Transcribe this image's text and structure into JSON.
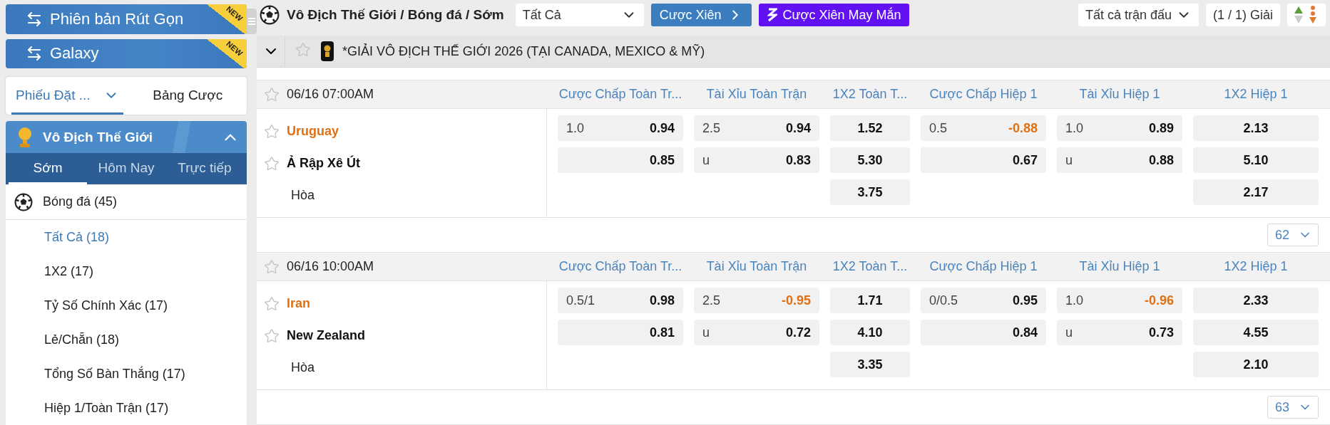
{
  "sidebar": {
    "banners": [
      {
        "label": "Phiên bản Rút Gọn",
        "badge": "NEW"
      },
      {
        "label": "Galaxy",
        "badge": "NEW"
      }
    ],
    "tabs": [
      {
        "label": "Phiếu Đặt ...",
        "selected": true,
        "dropdown": true
      },
      {
        "label": "Bảng Cược",
        "selected": false,
        "dropdown": false
      }
    ],
    "section": {
      "title": "Vô Địch Thế Giới",
      "expanded": true,
      "tabs": [
        {
          "label": "Sớm",
          "selected": true
        },
        {
          "label": "Hôm Nay",
          "selected": false
        },
        {
          "label": "Trực tiếp",
          "selected": false
        }
      ],
      "sport": {
        "label": "Bóng đá",
        "count": "(45)"
      },
      "items": [
        {
          "label": "Tất Cả",
          "count": "(18)",
          "selected": true
        },
        {
          "label": "1X2",
          "count": "(17)",
          "selected": false
        },
        {
          "label": "Tỷ Số Chính Xác",
          "count": "(17)",
          "selected": false
        },
        {
          "label": "Lẻ/Chẵn",
          "count": "(18)",
          "selected": false
        },
        {
          "label": "Tổng Số Bàn Thắng",
          "count": "(17)",
          "selected": false
        },
        {
          "label": "Hiệp 1/Toàn Trận",
          "count": "(17)",
          "selected": false
        }
      ]
    }
  },
  "toolbar": {
    "breadcrumb": "Vô Địch Thế Giới / Bóng đá / Sớm",
    "filter": "Tất Cả",
    "parlay_button": "Cược Xiên",
    "lucky_parlay_button": "Cược Xiên May Mắn",
    "match_filter": "Tất cả trận đấu",
    "league_count": "(1 / 1) Giải"
  },
  "league": {
    "title": "*GIẢI VÔ ĐỊCH THẾ GIỚI 2026 (TẠI CANADA, MEXICO & MỸ)",
    "expanded": true
  },
  "matches": [
    {
      "time": "06/16 07:00AM",
      "columns": [
        "Cược Chấp Toàn Tr...",
        "Tài Xỉu Toàn Trận",
        "1X2 Toàn T...",
        "Cược Chấp Hiệp 1",
        "Tài Xỉu Hiệp 1",
        "1X2 Hiệp 1"
      ],
      "teams": [
        {
          "name": "Uruguay",
          "favored": true
        },
        {
          "name": "Ả Rập Xê Út",
          "favored": false
        }
      ],
      "draw_label": "Hòa",
      "more": "62",
      "markets": [
        {
          "kind": "line",
          "cells": [
            {
              "line": "1.0",
              "odds": "0.94",
              "negative": false
            },
            {
              "odds": "0.85",
              "negative": false
            }
          ]
        },
        {
          "kind": "line",
          "cells": [
            {
              "line": "2.5",
              "odds": "0.94",
              "negative": false
            },
            {
              "line": "u",
              "odds": "0.83",
              "negative": false
            }
          ]
        },
        {
          "kind": "price",
          "cells": [
            {
              "odds": "1.52",
              "negative": false
            },
            {
              "odds": "5.30",
              "negative": false
            },
            {
              "odds": "3.75",
              "negative": false
            }
          ]
        },
        {
          "kind": "line",
          "cells": [
            {
              "line": "0.5",
              "odds": "-0.88",
              "negative": true
            },
            {
              "odds": "0.67",
              "negative": false
            }
          ]
        },
        {
          "kind": "line",
          "cells": [
            {
              "line": "1.0",
              "odds": "0.89",
              "negative": false
            },
            {
              "line": "u",
              "odds": "0.88",
              "negative": false
            }
          ]
        },
        {
          "kind": "price",
          "cells": [
            {
              "odds": "2.13",
              "negative": false
            },
            {
              "odds": "5.10",
              "negative": false
            },
            {
              "odds": "2.17",
              "negative": false
            }
          ]
        }
      ]
    },
    {
      "time": "06/16 10:00AM",
      "columns": [
        "Cược Chấp Toàn Tr...",
        "Tài Xỉu Toàn Trận",
        "1X2 Toàn T...",
        "Cược Chấp Hiệp 1",
        "Tài Xỉu Hiệp 1",
        "1X2 Hiệp 1"
      ],
      "teams": [
        {
          "name": "Iran",
          "favored": true
        },
        {
          "name": "New Zealand",
          "favored": false
        }
      ],
      "draw_label": "Hòa",
      "more": "63",
      "markets": [
        {
          "kind": "line",
          "cells": [
            {
              "line": "0.5/1",
              "odds": "0.98",
              "negative": false
            },
            {
              "odds": "0.81",
              "negative": false
            }
          ]
        },
        {
          "kind": "line",
          "cells": [
            {
              "line": "2.5",
              "odds": "-0.95",
              "negative": true
            },
            {
              "line": "u",
              "odds": "0.72",
              "negative": false
            }
          ]
        },
        {
          "kind": "price",
          "cells": [
            {
              "odds": "1.71",
              "negative": false
            },
            {
              "odds": "4.10",
              "negative": false
            },
            {
              "odds": "3.35",
              "negative": false
            }
          ]
        },
        {
          "kind": "line",
          "cells": [
            {
              "line": "0/0.5",
              "odds": "0.95",
              "negative": false
            },
            {
              "odds": "0.84",
              "negative": false
            }
          ]
        },
        {
          "kind": "line",
          "cells": [
            {
              "line": "1.0",
              "odds": "-0.96",
              "negative": true
            },
            {
              "line": "u",
              "odds": "0.73",
              "negative": false
            }
          ]
        },
        {
          "kind": "price",
          "cells": [
            {
              "odds": "2.33",
              "negative": false
            },
            {
              "odds": "4.55",
              "negative": false
            },
            {
              "odds": "2.10",
              "negative": false
            }
          ]
        }
      ]
    }
  ]
}
